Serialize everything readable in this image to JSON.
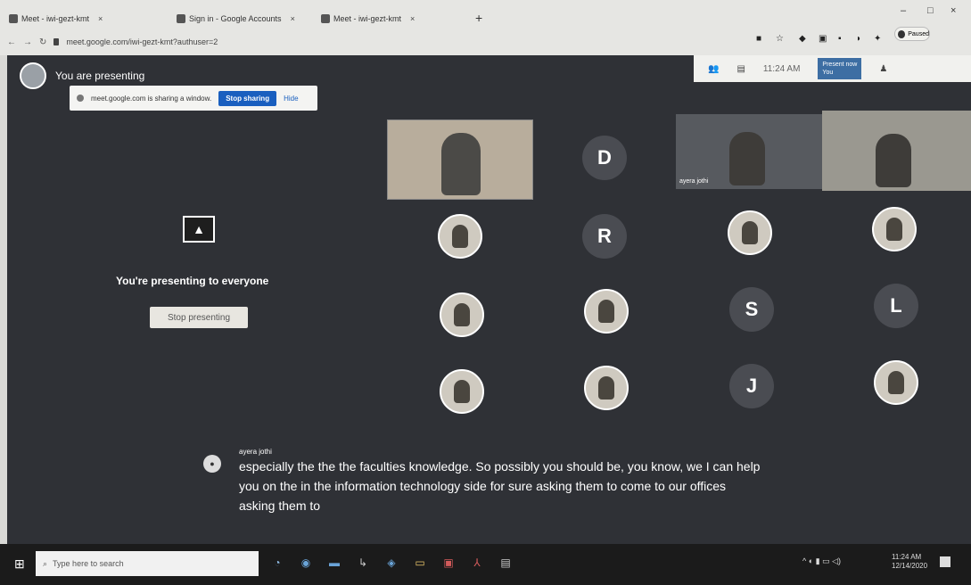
{
  "browser": {
    "tabs": [
      {
        "label": "Meet - iwi-gezt-kmt",
        "favicon": "meet-icon"
      },
      {
        "label": "Sign in - Google Accounts",
        "favicon": "google-icon"
      },
      {
        "label": "Meet - iwi-gezt-kmt",
        "favicon": "meet-icon"
      }
    ],
    "new_tab_symbol": "+",
    "url": "meet.google.com/iwi-gezt-kmt?authuser=2",
    "profile_label": "Paused",
    "window_controls": {
      "minimize": "–",
      "maximize": "□",
      "close": "×"
    }
  },
  "meet": {
    "presenting_label": "You are presenting",
    "sharebar": {
      "text": "meet.google.com is sharing a window.",
      "stop_button": "Stop sharing",
      "hide_button": "Hide"
    },
    "topbar": {
      "clock": "11:24 AM",
      "present_now_label": "Present now",
      "present_now_sub": "You"
    },
    "speaker_name": "ayera jothi",
    "tiles": [
      {
        "type": "photo"
      },
      {
        "type": "initial",
        "letter": "D"
      },
      {
        "type": "photo"
      },
      {
        "type": "initial",
        "letter": "R"
      },
      {
        "type": "photo"
      },
      {
        "type": "photo"
      },
      {
        "type": "photo"
      },
      {
        "type": "photo"
      },
      {
        "type": "initial",
        "letter": "S"
      },
      {
        "type": "initial",
        "letter": "L"
      },
      {
        "type": "photo"
      },
      {
        "type": "photo"
      },
      {
        "type": "initial",
        "letter": "J"
      },
      {
        "type": "photo"
      }
    ],
    "presenting_to": "You're presenting to everyone",
    "stop_presenting": "Stop presenting",
    "caption": {
      "speaker": "ayera jothi",
      "text": "especially the the the faculties knowledge. So possibly you should be, you know, we I can help you on the in the information technology side for sure asking them to come to our offices asking them to"
    }
  },
  "taskbar": {
    "search_placeholder": "Type here to search",
    "time": "11:24 AM",
    "date": "12/14/2020"
  }
}
